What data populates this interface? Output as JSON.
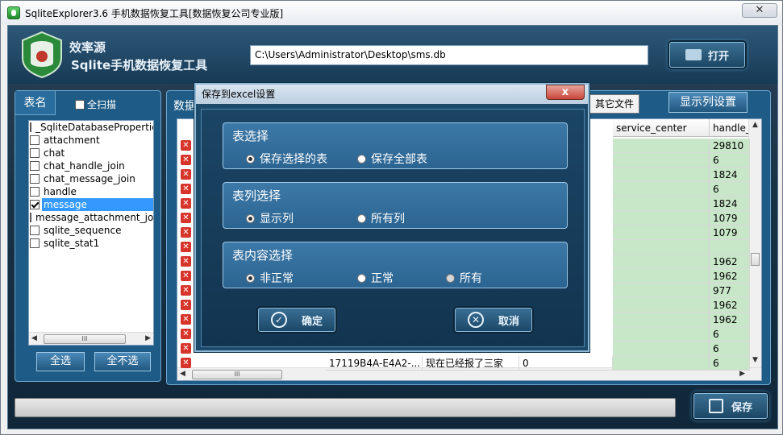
{
  "window": {
    "title": "SqliteExplorer3.6 手机数据恢复工具[数据恢复公司专业版]",
    "close_glyph": "✕"
  },
  "header": {
    "brand_line1": "效率源",
    "brand_line2": "Sqlite手机数据恢复工具",
    "path": "C:\\Users\\Administrator\\Desktop\\sms.db",
    "open_label": "打开"
  },
  "left": {
    "tab_label": "表名",
    "scan_all_label": "全扫描",
    "tables": [
      {
        "name": "_SqliteDatabaseProperties",
        "checked": false
      },
      {
        "name": "attachment",
        "checked": false
      },
      {
        "name": "chat",
        "checked": false
      },
      {
        "name": "chat_handle_join",
        "checked": false
      },
      {
        "name": "chat_message_join",
        "checked": false
      },
      {
        "name": "handle",
        "checked": false
      },
      {
        "name": "message",
        "checked": true
      },
      {
        "name": "message_attachment_join",
        "checked": false
      },
      {
        "name": "sqlite_sequence",
        "checked": false
      },
      {
        "name": "sqlite_stat1",
        "checked": false
      }
    ],
    "scroll_thumb": "III",
    "select_all": "全选",
    "select_none": "全不选"
  },
  "right": {
    "label": "数据",
    "other_files_label": "其它文件",
    "column_settings_label": "显示列设置",
    "columns": [
      "service_center",
      "handle_i"
    ],
    "handle_values": [
      "29810",
      "6",
      "1824",
      "6",
      "1824",
      "1079",
      "1079",
      "",
      "1962",
      "1962",
      "977",
      "1962",
      "1962",
      "6",
      "6",
      "6"
    ],
    "last_row": {
      "guid": "17119B4A-E4A2-...",
      "text": "现在已经报了三家",
      "num": "0"
    },
    "scroll_thumb": "III"
  },
  "footer": {
    "save_label": "保存"
  },
  "modal": {
    "title": "保存到excel设置",
    "close_glyph": "x",
    "groups": [
      {
        "title": "表选择",
        "options": [
          {
            "label": "保存选择的表",
            "selected": true
          },
          {
            "label": "保存全部表",
            "selected": false
          }
        ]
      },
      {
        "title": "表列选择",
        "options": [
          {
            "label": "显示列",
            "selected": true
          },
          {
            "label": "所有列",
            "selected": false
          }
        ]
      },
      {
        "title": "表内容选择",
        "options": [
          {
            "label": "非正常",
            "selected": true
          },
          {
            "label": "正常",
            "selected": false
          },
          {
            "label": "所有",
            "selected": false
          }
        ]
      }
    ],
    "confirm_label": "确定",
    "cancel_label": "取消"
  },
  "colors": {
    "accent": "#1e5b86",
    "highlight": "#3399ff",
    "row_green": "#c8e6c8",
    "error_red": "#d7342b"
  }
}
